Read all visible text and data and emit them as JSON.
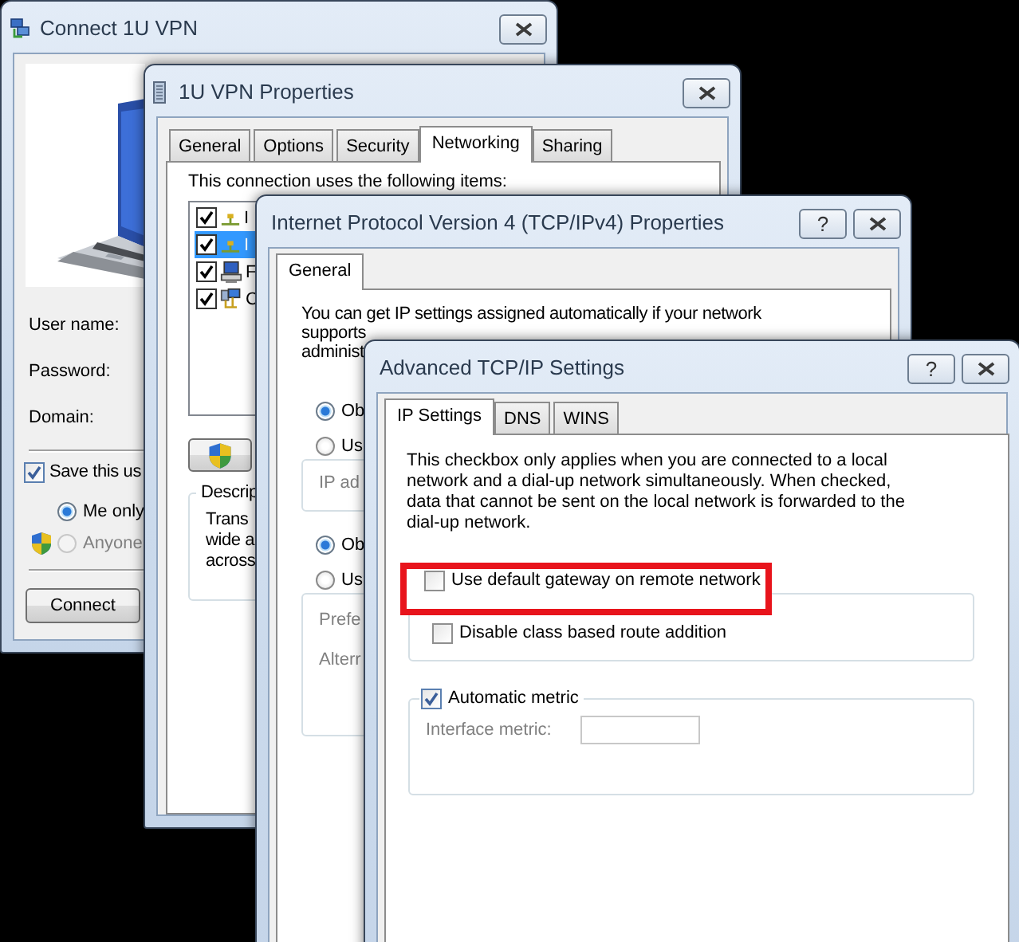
{
  "connect_window": {
    "title": "Connect 1U VPN",
    "fields": [
      {
        "label": "User name:"
      },
      {
        "label": "Password:"
      },
      {
        "label": "Domain:"
      }
    ],
    "save_credentials": {
      "label": "Save this us",
      "checked": true
    },
    "scope_options": [
      {
        "label": "Me only",
        "selected": true,
        "disabled": false
      },
      {
        "label": "Anyone",
        "selected": false,
        "disabled": true
      }
    ],
    "connect_button": "Connect"
  },
  "properties_window": {
    "title": "1U VPN Properties",
    "tabs": [
      {
        "label": "General",
        "selected": false
      },
      {
        "label": "Options",
        "selected": false
      },
      {
        "label": "Security",
        "selected": false
      },
      {
        "label": "Networking",
        "selected": true
      },
      {
        "label": "Sharing",
        "selected": false
      }
    ],
    "items_label": "This connection uses the following items:",
    "items": [
      {
        "kind": "protocol",
        "text": "I",
        "checked": true,
        "selected": false
      },
      {
        "kind": "protocol",
        "text": "I",
        "checked": true,
        "selected": true
      },
      {
        "kind": "service",
        "text": "F",
        "checked": true,
        "selected": false
      },
      {
        "kind": "client",
        "text": "C",
        "checked": true,
        "selected": false
      }
    ],
    "description": {
      "legend": "Descrip",
      "lines": [
        "Trans",
        "wide a",
        "across"
      ]
    }
  },
  "ipv4_window": {
    "title": "Internet Protocol Version 4 (TCP/IPv4) Properties",
    "help_button": "?",
    "tabs": [
      {
        "label": "General",
        "selected": true
      }
    ],
    "intro_lines": [
      "You can get IP settings assigned automatically if your network",
      "supports",
      "administ"
    ],
    "ip_options": [
      {
        "label": "Ob",
        "selected": true
      },
      {
        "label": "Us",
        "selected": false
      }
    ],
    "ip_fields": [
      {
        "label": "IP ad",
        "disabled": true
      }
    ],
    "dns_options": [
      {
        "label": "Ob",
        "selected": true
      },
      {
        "label": "Us",
        "selected": false
      }
    ],
    "dns_fields": [
      {
        "label": "Prefe",
        "disabled": true
      },
      {
        "label": "Alterr",
        "disabled": true
      }
    ]
  },
  "advanced_window": {
    "title": "Advanced TCP/IP Settings",
    "help_button": "?",
    "tabs": [
      {
        "label": "IP Settings",
        "selected": true
      },
      {
        "label": "DNS",
        "selected": false
      },
      {
        "label": "WINS",
        "selected": false
      }
    ],
    "note": "This checkbox only applies when you are connected to a local network and a dial-up network simultaneously. When checked, data that cannot be sent on the local network is forwarded to the dial-up network.",
    "gateway_options": [
      {
        "label": "Use default gateway on remote network",
        "checked": false,
        "highlighted": true
      },
      {
        "label": "Disable class based route addition",
        "checked": false,
        "highlighted": false
      }
    ],
    "automatic_metric": {
      "label": "Automatic metric",
      "checked": true
    },
    "interface_metric": {
      "label": "Interface metric:",
      "disabled": true
    }
  }
}
